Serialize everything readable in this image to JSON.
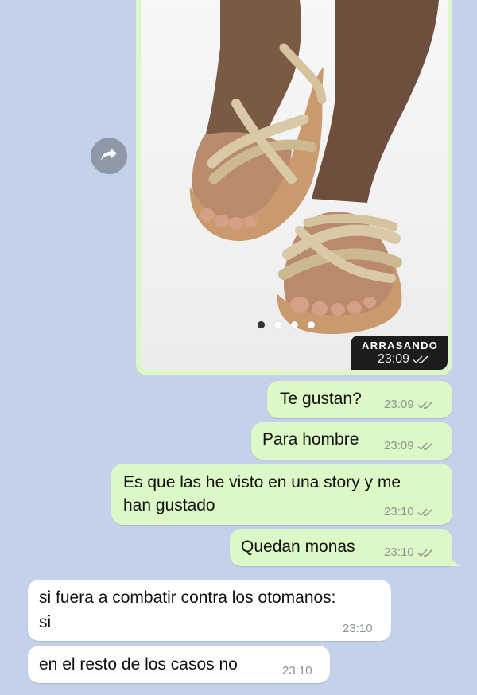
{
  "image_message": {
    "store_label": "ARRASANDO",
    "time": "23:09",
    "carousel_dots": 4,
    "active_dot": 0
  },
  "outgoing": [
    {
      "text": "Te gustan?",
      "time": "23:09"
    },
    {
      "text": "Para hombre",
      "time": "23:09"
    },
    {
      "line1": "Es que las he visto en una story y me",
      "line2": "han gustado",
      "time": "23:10"
    },
    {
      "text": "Quedan monas",
      "time": "23:10"
    }
  ],
  "incoming": [
    {
      "line1": "si fuera a combatir contra los otomanos:",
      "line2": "si",
      "time": "23:10"
    },
    {
      "text": "en el resto de los casos no",
      "time": "23:10"
    }
  ],
  "icons": {
    "forward": "forward-arrow-icon",
    "read_receipt": "double-check-icon"
  },
  "colors": {
    "background": "#c3d1ea",
    "outgoing_bubble": "#dcf8c6",
    "incoming_bubble": "#ffffff",
    "meta_text": "#8a9590"
  }
}
